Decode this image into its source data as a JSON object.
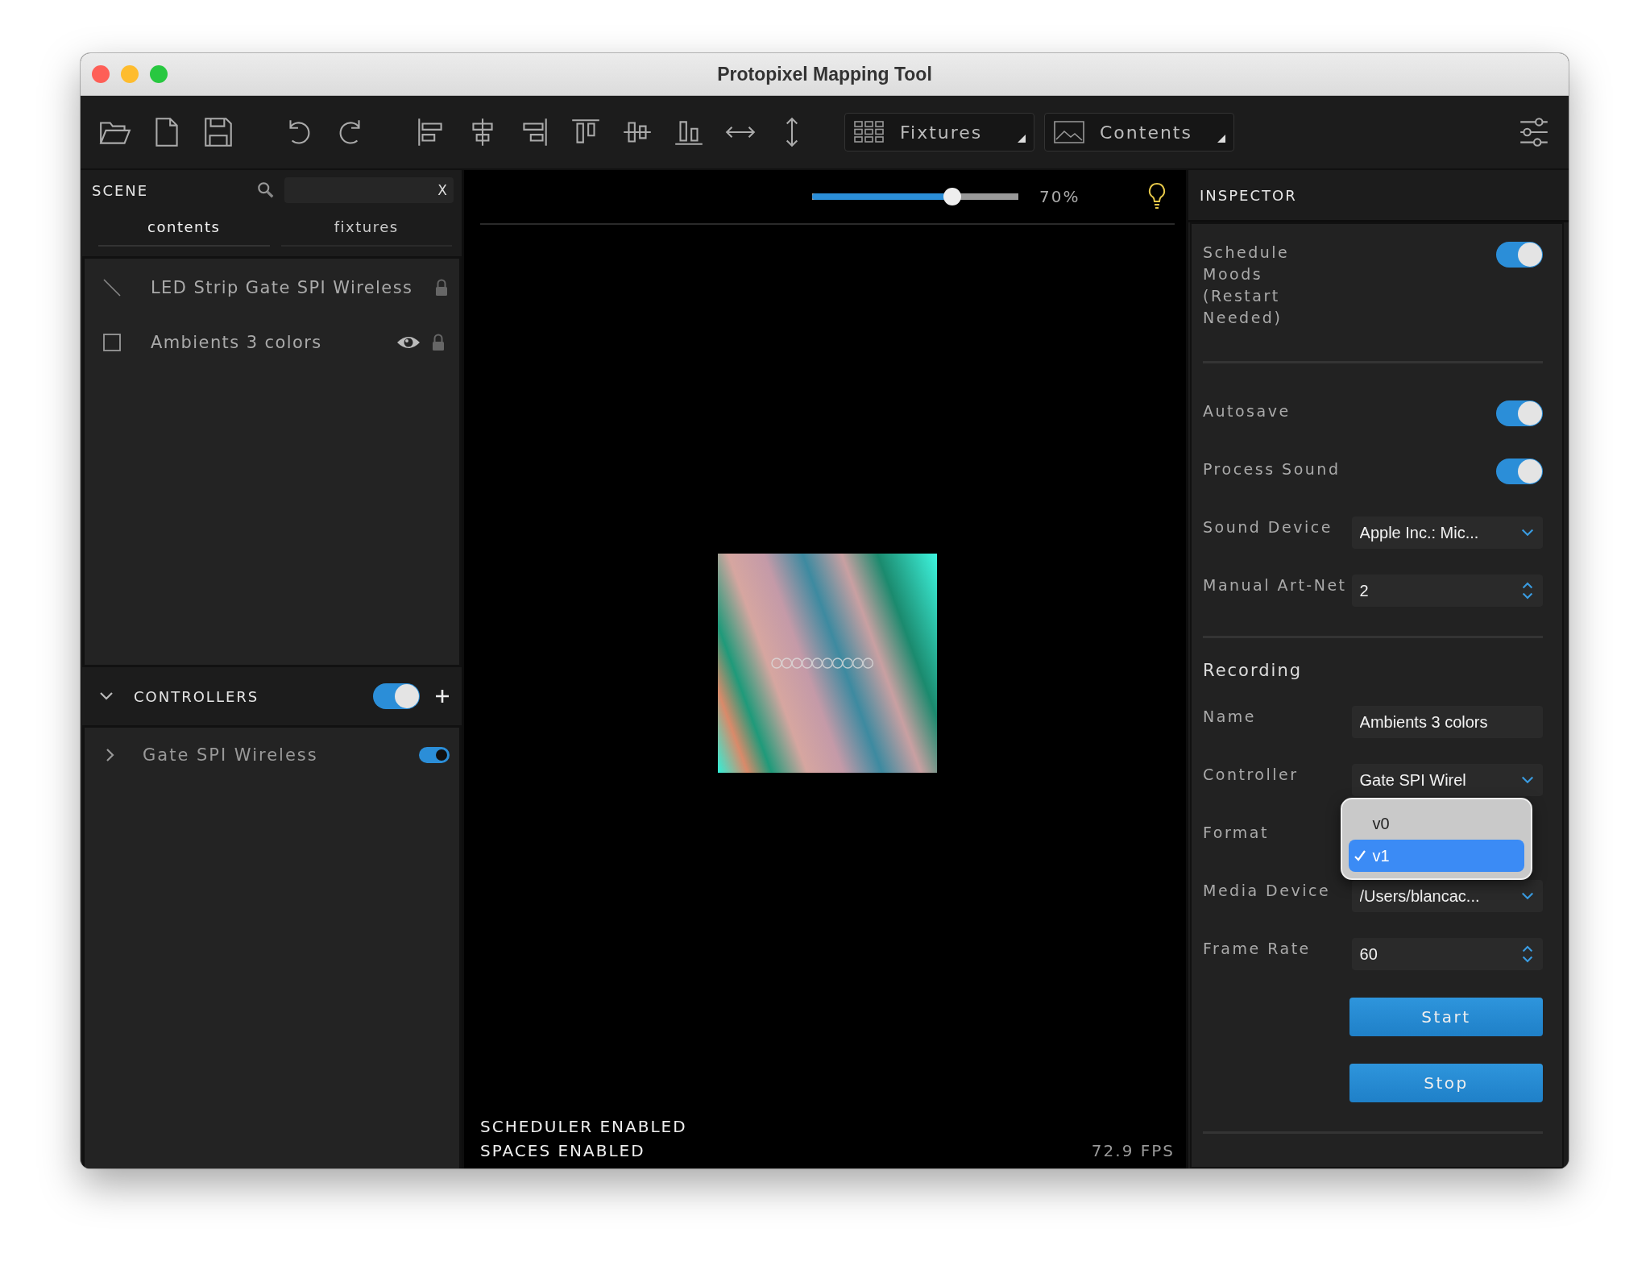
{
  "window": {
    "title": "Protopixel Mapping Tool"
  },
  "toolbar": {
    "dropdowns": [
      {
        "kind": "fixtures",
        "label": "Fixtures"
      },
      {
        "kind": "contents",
        "label": "Contents"
      }
    ]
  },
  "scene": {
    "title": "SCENE",
    "clear": "X",
    "tabs": [
      {
        "label": "contents",
        "selected": true
      },
      {
        "label": "fixtures",
        "selected": false
      }
    ],
    "items": [
      {
        "kind": "line",
        "label": "LED Strip Gate SPI Wireless",
        "visible": false,
        "locked": true
      },
      {
        "kind": "rect",
        "label": "Ambients 3 colors",
        "visible": true,
        "locked": true
      }
    ]
  },
  "controllers": {
    "title": "CONTROLLERS",
    "expanded": true,
    "on": true,
    "items": [
      {
        "label": "Gate SPI Wireless",
        "expanded": false,
        "on": true
      }
    ]
  },
  "canvas": {
    "zoom": {
      "level": 0.68,
      "reading": "70%"
    },
    "status": [
      "SCHEDULER ENABLED",
      "SPACES ENABLED"
    ],
    "fps": "72.9 FPS"
  },
  "inspector": {
    "title": "INSPECTOR",
    "groups": [
      {
        "rows": [
          {
            "kind": "toggle",
            "label": "Schedule Moods (Restart Needed)",
            "on": true
          }
        ]
      },
      {
        "rows": [
          {
            "kind": "toggle",
            "label": "Autosave",
            "on": true
          },
          {
            "kind": "toggle",
            "label": "Process Sound",
            "on": true
          },
          {
            "kind": "select",
            "label": "Sound Device",
            "value": "Apple Inc.: Mic..."
          },
          {
            "kind": "number",
            "label": "Manual Art-Net",
            "value": "2"
          }
        ]
      },
      {
        "heading": "Recording",
        "rows": [
          {
            "kind": "text",
            "label": "Name",
            "value": "Ambients 3 colors"
          },
          {
            "kind": "select",
            "label": "Controller",
            "value": "Gate SPI Wirel"
          },
          {
            "kind": "menu",
            "label": "Format",
            "options": [
              {
                "label": "v0",
                "selected": false
              },
              {
                "label": "v1",
                "selected": true
              }
            ]
          },
          {
            "kind": "select",
            "label": "Media Device",
            "value": "/Users/blancac..."
          },
          {
            "kind": "number",
            "label": "Frame Rate",
            "value": "60"
          }
        ],
        "buttons": [
          "Start",
          "Stop"
        ]
      }
    ]
  }
}
